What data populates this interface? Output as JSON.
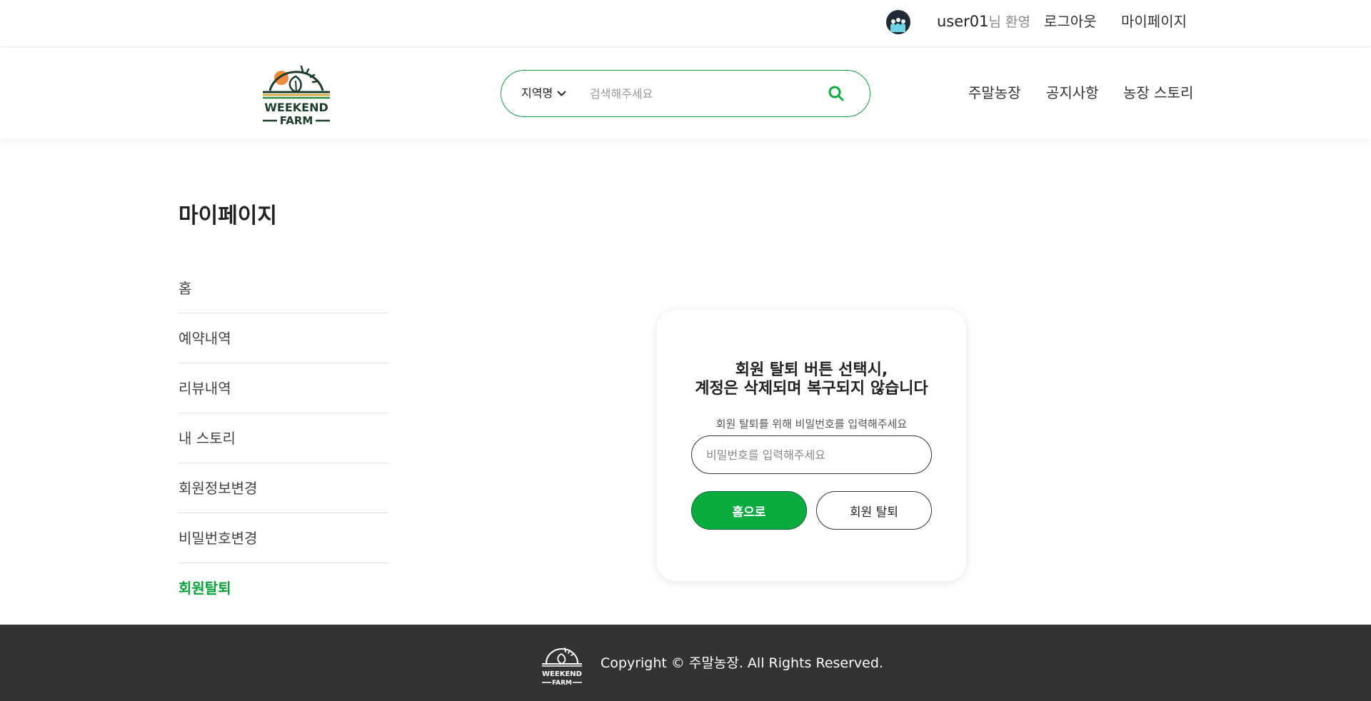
{
  "topbar": {
    "username": "user01",
    "welcome_suffix": "님 환영",
    "logout_label": "로그아웃",
    "mypage_label": "마이페이지"
  },
  "header": {
    "logo_text_top": "WEEKEND",
    "logo_text_bottom": "FARM",
    "search": {
      "region_label": "지역명",
      "placeholder": "검색해주세요"
    },
    "nav": [
      "주말농장",
      "공지사항",
      "농장 스토리"
    ]
  },
  "page": {
    "title": "마이페이지"
  },
  "side_menu": {
    "items": [
      "홈",
      "예약내역",
      "리뷰내역",
      "내 스토리",
      "회원정보변경",
      "비밀번호변경",
      "회원탈퇴"
    ],
    "active": "회원탈퇴"
  },
  "card": {
    "title_line1": "회원 탈퇴 버튼 선택시,",
    "title_line2": "계정은 삭제되며 복구되지 않습니다",
    "label": "회원 탈퇴를 위해 비밀번호를 입력해주세요",
    "password_placeholder": "비밀번호를 입력해주세요",
    "home_button": "홈으로",
    "withdraw_button": "회원 탈퇴"
  },
  "footer": {
    "logo_text_top": "WEEKEND",
    "logo_text_bottom": "FARM",
    "copyright": "Copyright © 주말농장. All Rights Reserved."
  },
  "colors": {
    "brand_green": "#0aac3d",
    "active_menu": "#0aa33a",
    "footer_bg": "#333333",
    "logo_sun": "#f08a3c",
    "logo_dark": "#1c3d2a"
  },
  "icons": {
    "search": "search-icon",
    "dropdown": "chevron-down-icon",
    "avatar": "avatar"
  }
}
